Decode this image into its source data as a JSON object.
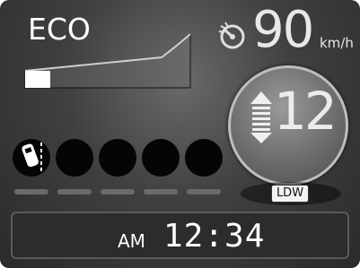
{
  "eco": {
    "label": "ECO",
    "level": 0.15
  },
  "speed": {
    "value": "90",
    "unit": "km/h",
    "icon": "speedometer-icon"
  },
  "gear": {
    "number": "12",
    "icon": "shift-up-down-arrows-icon"
  },
  "ldw": {
    "label": "LDW"
  },
  "drive_indicators": {
    "count": 5,
    "active_index": 0,
    "active_icon": "lane-departure-car-icon"
  },
  "clock": {
    "ampm": "AM",
    "time": "12:34"
  }
}
